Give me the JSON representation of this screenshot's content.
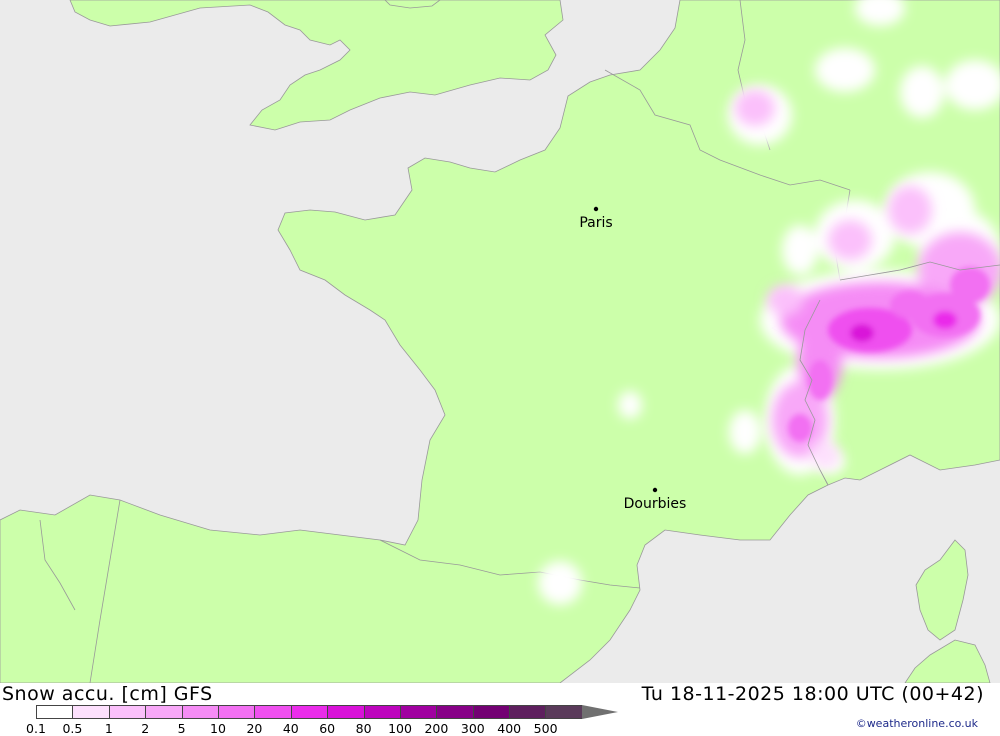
{
  "map": {
    "cities": [
      {
        "name": "Paris"
      },
      {
        "name": "Dourbies"
      }
    ],
    "colors": {
      "sea": "#ebebeb",
      "land": "#ccffaa",
      "border": "#999999"
    }
  },
  "header": {
    "left_title": "Snow accu. [cm] GFS",
    "right_title": "Tu 18-11-2025 18:00 UTC (00+42)",
    "credit": "©weatheronline.co.uk"
  },
  "legend": {
    "labels": [
      "0.1",
      "0.5",
      "1",
      "2",
      "5",
      "10",
      "20",
      "40",
      "60",
      "80",
      "100",
      "200",
      "300",
      "400",
      "500"
    ],
    "colors": [
      "#ffffff",
      "#fde0fd",
      "#fbc0fb",
      "#f8a8f8",
      "#f58cf5",
      "#f270f2",
      "#ef50ef",
      "#ea2cea",
      "#d912d9",
      "#bd05bd",
      "#a000a0",
      "#870087",
      "#730073",
      "#5e1f5e",
      "#5a3a5a"
    ],
    "arrow_color": "#707070"
  }
}
